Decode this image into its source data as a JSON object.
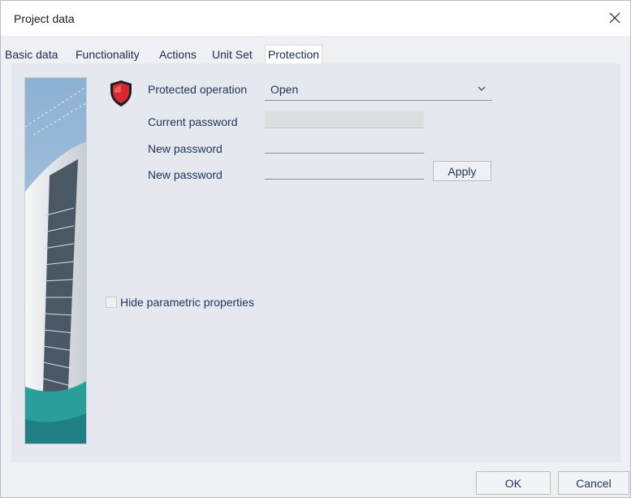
{
  "window": {
    "title": "Project data",
    "close_icon": "close-icon"
  },
  "tabs": [
    {
      "label": "Basic data",
      "active": false
    },
    {
      "label": "Functionality",
      "active": false
    },
    {
      "label": "Actions",
      "active": false
    },
    {
      "label": "Unit Set",
      "active": false
    },
    {
      "label": "Protection",
      "active": true
    }
  ],
  "protection": {
    "shield_icon": "shield-icon",
    "protected_operation_label": "Protected operation",
    "protected_operation_value": "Open",
    "current_password_label": "Current password",
    "new_password_label": "New password",
    "confirm_password_label": "New password",
    "apply_label": "Apply",
    "hide_parametric_label": "Hide parametric properties",
    "hide_parametric_checked": false
  },
  "footer": {
    "ok_label": "OK",
    "cancel_label": "Cancel"
  },
  "colors": {
    "accent": "#1e3557",
    "shield_red": "#d7282f",
    "background": "#eef0f4"
  }
}
